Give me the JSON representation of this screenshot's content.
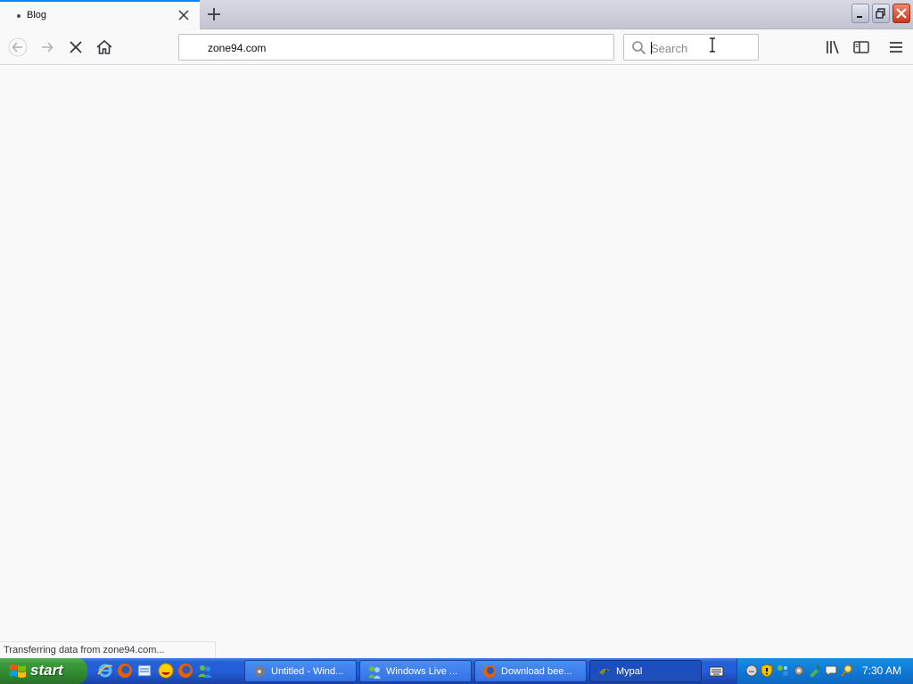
{
  "browser": {
    "tab": {
      "title": "Blog",
      "close_icon": "close-icon"
    },
    "new_tab_icon": "plus-icon",
    "url": "zone94.com",
    "search": {
      "placeholder": "Search",
      "value": ""
    },
    "status_text": "Transferring data from zone94.com...",
    "accent_color": "#0a84ff"
  },
  "taskbar": {
    "start_label": "start",
    "quick_launch": [
      "internet-explorer-icon",
      "firefox-icon",
      "outlook-express-icon",
      "messenger-smiley-icon",
      "firefox-icon",
      "windows-live-messenger-icon"
    ],
    "tasks": [
      {
        "label": "Untitled - Wind...",
        "icon": "windows-media-icon",
        "active": false
      },
      {
        "label": "Windows Live ...",
        "icon": "windows-live-messenger-icon",
        "active": false
      },
      {
        "label": "Download bee...",
        "icon": "firefox-icon",
        "active": false
      },
      {
        "label": "Mypal",
        "icon": "mypal-icon",
        "active": true
      }
    ],
    "clock": "7:30 AM"
  }
}
